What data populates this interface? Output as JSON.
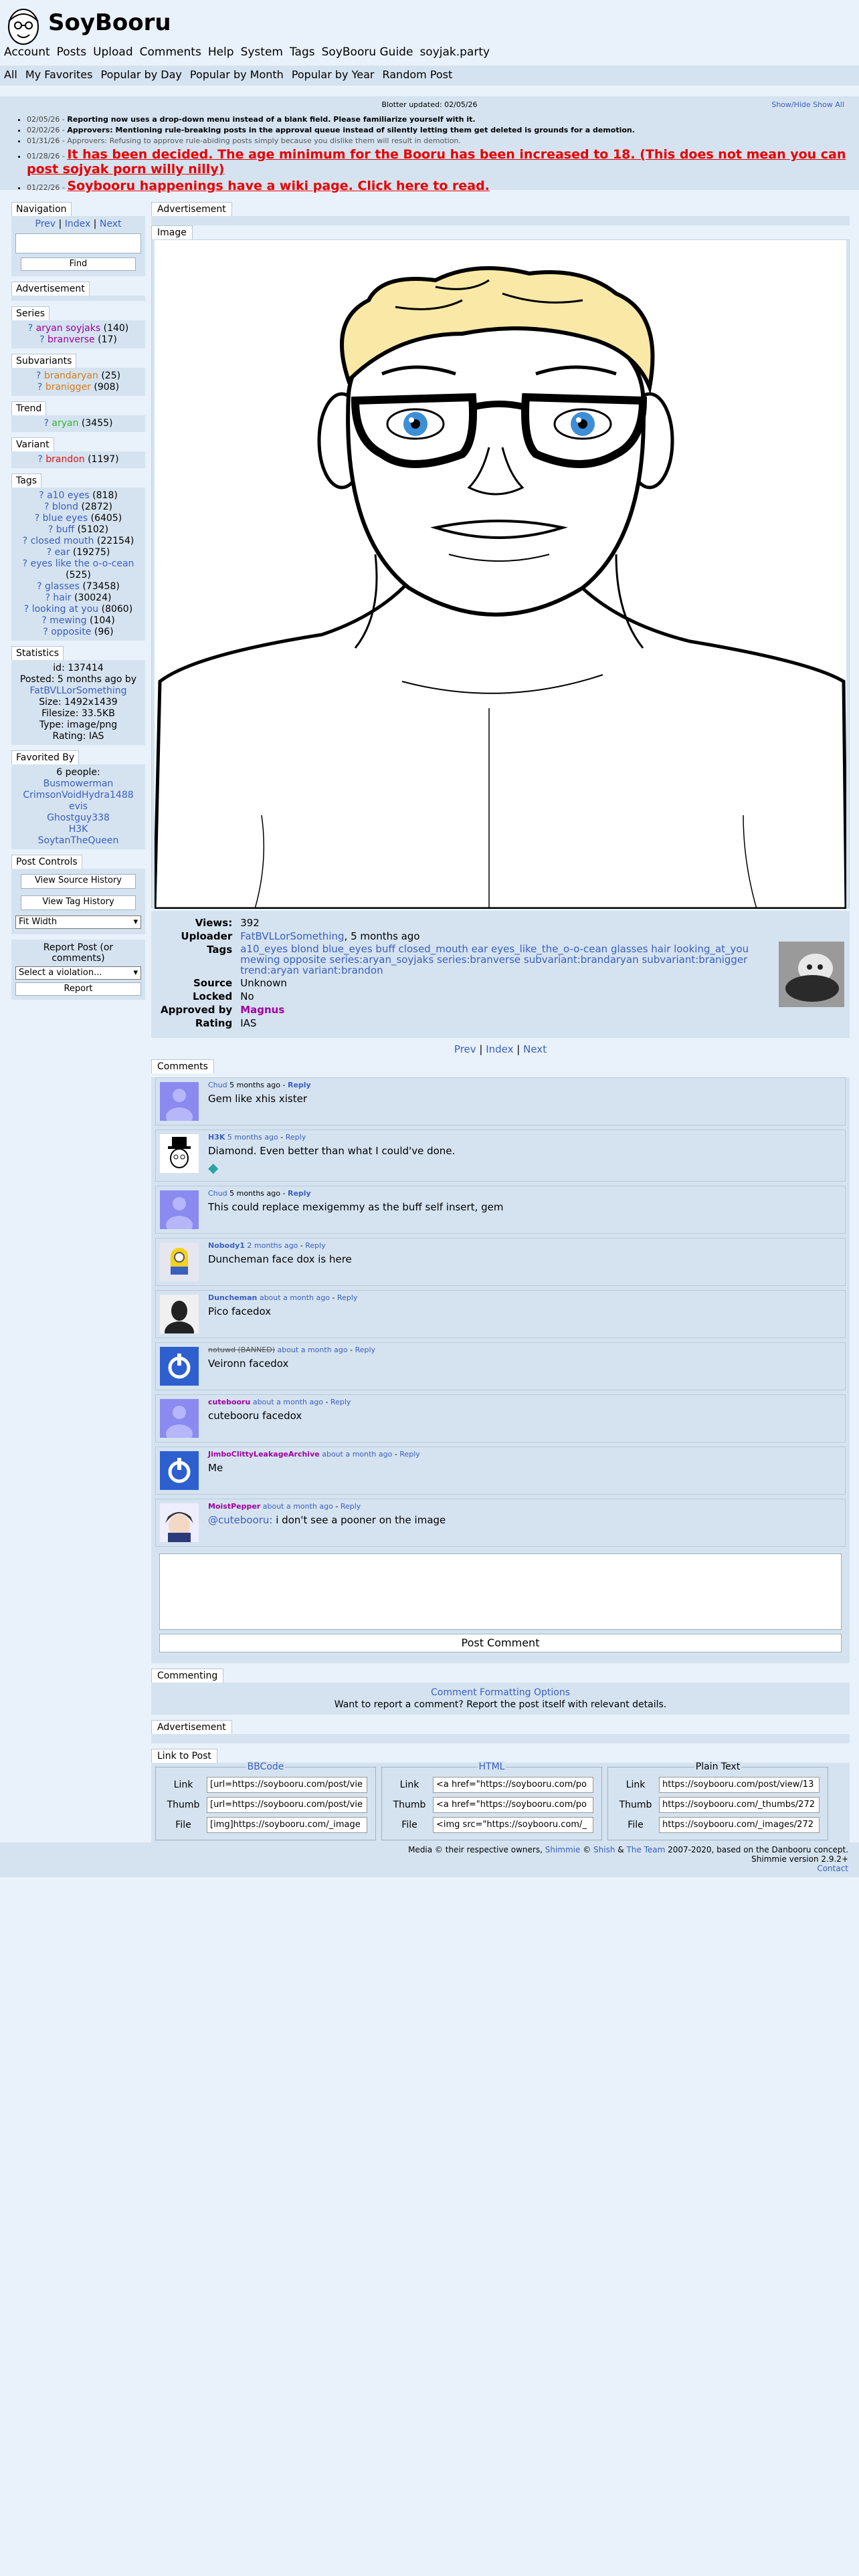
{
  "site": {
    "title": "SoyBooru"
  },
  "main_nav": [
    "Account",
    "Posts",
    "Upload",
    "Comments",
    "Help",
    "System",
    "Tags",
    "SoyBooru Guide",
    "soyjak.party"
  ],
  "sub_nav": [
    "All",
    "My Favorites",
    "Popular by Day",
    "Popular by Month",
    "Popular by Year",
    "Random Post"
  ],
  "blotter": {
    "updated": "Blotter updated: 02/05/26",
    "toggle": "Show/Hide Show All",
    "entries": [
      {
        "date": "02/05/26 -",
        "text": "Reporting now uses a drop-down menu instead of a blank field. Please familiarize yourself with it."
      },
      {
        "date": "02/02/26 -",
        "text": "Approvers: Mentioning rule-breaking posts in the approval queue instead of silently letting them get deleted is grounds for a demotion."
      },
      {
        "date": "01/31/26 -",
        "text": "Approvers: Refusing to approve rule-abiding posts simply because you dislike them will result in demotion."
      },
      {
        "date": "01/28/26 -",
        "text": "It has been decided. The age minimum for the Booru has been increased to 18. (This does not mean you can post sojyak porn willy nilly)"
      },
      {
        "date": "01/22/26 -",
        "text": "Soybooru happenings have a wiki page. Click here to read."
      }
    ]
  },
  "navigation": {
    "title": "Navigation",
    "prev": "Prev",
    "index": "Index",
    "next": "Next",
    "find": "Find"
  },
  "advertisement_label": "Advertisement",
  "series": {
    "title": "Series",
    "items": [
      {
        "name": "aryan soyjaks",
        "count": "(140)"
      },
      {
        "name": "branverse",
        "count": "(17)"
      }
    ]
  },
  "subvariants": {
    "title": "Subvariants",
    "items": [
      {
        "name": "brandaryan",
        "count": "(25)"
      },
      {
        "name": "branigger",
        "count": "(908)"
      }
    ]
  },
  "trend": {
    "title": "Trend",
    "items": [
      {
        "name": "aryan",
        "count": "(3455)"
      }
    ]
  },
  "variant": {
    "title": "Variant",
    "items": [
      {
        "name": "brandon",
        "count": "(1197)"
      }
    ]
  },
  "tags": {
    "title": "Tags",
    "items": [
      {
        "name": "a10 eyes",
        "count": "(818)"
      },
      {
        "name": "blond",
        "count": "(2872)"
      },
      {
        "name": "blue eyes",
        "count": "(6405)"
      },
      {
        "name": "buff",
        "count": "(5102)"
      },
      {
        "name": "closed mouth",
        "count": "(22154)"
      },
      {
        "name": "ear",
        "count": "(19275)"
      },
      {
        "name": "eyes like the o-o-cean",
        "count": "(525)"
      },
      {
        "name": "glasses",
        "count": "(73458)"
      },
      {
        "name": "hair",
        "count": "(30024)"
      },
      {
        "name": "looking at you",
        "count": "(8060)"
      },
      {
        "name": "mewing",
        "count": "(104)"
      },
      {
        "name": "opposite",
        "count": "(96)"
      }
    ]
  },
  "statistics": {
    "title": "Statistics",
    "id": "id: 137414",
    "posted": "Posted: 5 months ago by",
    "poster": "FatBVLLorSomething",
    "size": "Size: 1492x1439",
    "filesize": "Filesize: 33.5KB",
    "type": "Type: image/png",
    "rating": "Rating: IAS"
  },
  "favorited": {
    "title": "Favorited By",
    "count": "6 people:",
    "users": [
      "Busmowerman",
      "CrimsonVoidHydra1488",
      "evis",
      "Ghostguy338",
      "H3K",
      "SoytanTheQueen"
    ]
  },
  "post_controls": {
    "title": "Post Controls",
    "view_source": "View Source History",
    "view_tag": "View Tag History",
    "fit": "Fit Width",
    "report_label": "Report Post (or comments)",
    "report_select": "Select a violation...",
    "report_btn": "Report"
  },
  "image_label": "Image",
  "info": {
    "views_k": "Views:",
    "views": "392",
    "uploader_k": "Uploader",
    "uploader": "FatBVLLorSomething",
    "uploader_time": ", 5 months ago",
    "tags_k": "Tags",
    "tags": "a10_eyes blond blue_eyes buff closed_mouth ear eyes_like_the_o-o-cean glasses hair looking_at_you mewing opposite series:aryan_soyjaks series:branverse subvariant:brandaryan subvariant:branigger trend:aryan variant:brandon",
    "source_k": "Source",
    "source": "Unknown",
    "locked_k": "Locked",
    "locked": "No",
    "approved_k": "Approved by",
    "approved": "Magnus",
    "rating_k": "Rating",
    "rating": "IAS"
  },
  "paginator": {
    "prev": "Prev",
    "index": "Index",
    "next": "Next"
  },
  "comments_label": "Comments",
  "comments": [
    {
      "user": "Chud",
      "time": "5 months ago",
      "reply": "Reply",
      "text": "Gem like xhis xister"
    },
    {
      "user": "H3K",
      "time": "5 months ago",
      "reply": "Reply",
      "text": "Diamond. Even better than what I could've done."
    },
    {
      "user": "Chud",
      "time": "5 months ago",
      "reply": "Reply",
      "text": "This could replace mexigemmy as the buff self insert, gem"
    },
    {
      "user": "Nobody1",
      "time": "2 months ago",
      "reply": "Reply",
      "text": "Duncheman face dox is here"
    },
    {
      "user": "Duncheman",
      "time": "about a month ago",
      "reply": "Reply",
      "text": "Pico facedox"
    },
    {
      "user": "notuwd (BANNED)",
      "time": "about a month ago",
      "reply": "Reply",
      "text": "Veironn facedox"
    },
    {
      "user": "cutebooru",
      "time": "about a month ago",
      "reply": "Reply",
      "text": "cutebooru facedox"
    },
    {
      "user": "JimboClittyLeakageArchive",
      "time": "about a month ago",
      "reply": "Reply",
      "text": "Me"
    },
    {
      "user": "MoistPepper",
      "time": "about a month ago",
      "reply": "Reply",
      "mention": "@cutebooru:",
      "text": " i don't see a pooner on the image"
    }
  ],
  "post_comment": "Post Comment",
  "commenting": {
    "title": "Commenting",
    "link": "Comment Formatting Options",
    "note": "Want to report a comment? Report the post itself with relevant details."
  },
  "link_to_post": {
    "title": "Link to Post",
    "groups": [
      {
        "legend": "BBCode",
        "link": "[url=https://soybooru.com/post/vie",
        "thumb": "[url=https://soybooru.com/post/vie",
        "file": "[img]https://soybooru.com/_image"
      },
      {
        "legend": "HTML",
        "link": "<a href=\"https://soybooru.com/po",
        "thumb": "<a href=\"https://soybooru.com/po",
        "file": "<img src=\"https://soybooru.com/_"
      },
      {
        "legend": "Plain Text",
        "link": "https://soybooru.com/post/view/13",
        "thumb": "https://soybooru.com/_thumbs/272",
        "file": "https://soybooru.com/_images/272"
      }
    ],
    "labels": {
      "link": "Link",
      "thumb": "Thumb",
      "file": "File"
    }
  },
  "footer": {
    "line1_pre": "Media © their respective owners, ",
    "shimmie": "Shimmie",
    "copy": " © ",
    "shish": "Shish",
    "amp": " & ",
    "team": "The Team",
    "line1_post": " 2007-2020, based on the Danbooru concept.",
    "version": "Shimmie version 2.9.2+",
    "contact": "Contact"
  }
}
